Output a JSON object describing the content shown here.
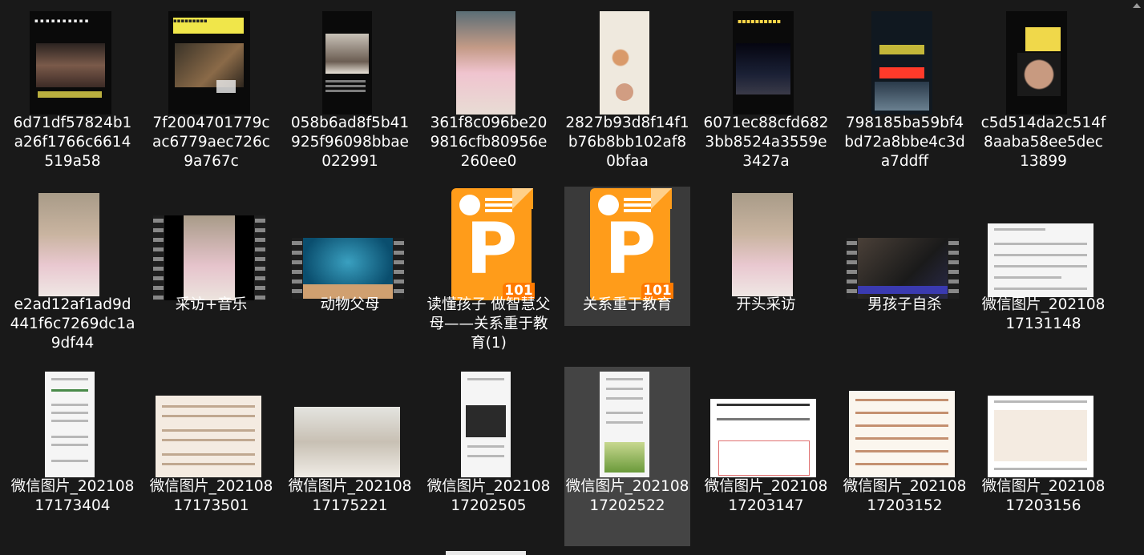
{
  "files": [
    {
      "name": "6d71df57824b1a26f1766c6614519a58",
      "kind": "video-portrait"
    },
    {
      "name": "7f2004701779cac6779aec726c9a767c",
      "kind": "video-portrait"
    },
    {
      "name": "058b6ad8f5b41925f96098bbae022991",
      "kind": "video-portrait"
    },
    {
      "name": "361f8c096be209816cfb80956e260ee0",
      "kind": "photo"
    },
    {
      "name": "2827b93d8f14f1b76b8bb102af80bfaa",
      "kind": "video-portrait"
    },
    {
      "name": "6071ec88cfd6823bb8524a3559e3427a",
      "kind": "video-portrait"
    },
    {
      "name": "798185ba59bf4bd72a8bbe4c3da7ddff",
      "kind": "video-portrait"
    },
    {
      "name": "c5d514da2c514f8aaba58ee5dec13899",
      "kind": "video-portrait"
    },
    {
      "name": "e2ad12af1ad9d441f6c7269dc1a9df44",
      "kind": "photo"
    },
    {
      "name": "采访+音乐",
      "kind": "video-film"
    },
    {
      "name": "动物父母",
      "kind": "video-film"
    },
    {
      "name": "读懂孩子 做智慧父母——关系重于教育(1)",
      "kind": "ppt"
    },
    {
      "name": "关系重于教育",
      "kind": "ppt"
    },
    {
      "name": "开头采访",
      "kind": "photo"
    },
    {
      "name": "男孩子自杀",
      "kind": "video-film"
    },
    {
      "name": "微信图片_20210817131148",
      "kind": "doc"
    },
    {
      "name": "微信图片_20210817173404",
      "kind": "doc"
    },
    {
      "name": "微信图片_20210817173501",
      "kind": "doc"
    },
    {
      "name": "微信图片_20210817175221",
      "kind": "photo"
    },
    {
      "name": "微信图片_20210817202505",
      "kind": "doc"
    },
    {
      "name": "微信图片_20210817202522",
      "kind": "doc"
    },
    {
      "name": "微信图片_20210817203147",
      "kind": "doc"
    },
    {
      "name": "微信图片_20210817203152",
      "kind": "doc"
    },
    {
      "name": "微信图片_20210817203156",
      "kind": "doc"
    }
  ],
  "ppt_badge": "101",
  "colors": {
    "background": "#191919",
    "selection": "#444444",
    "ppt_orange": "#ff9c1a"
  }
}
